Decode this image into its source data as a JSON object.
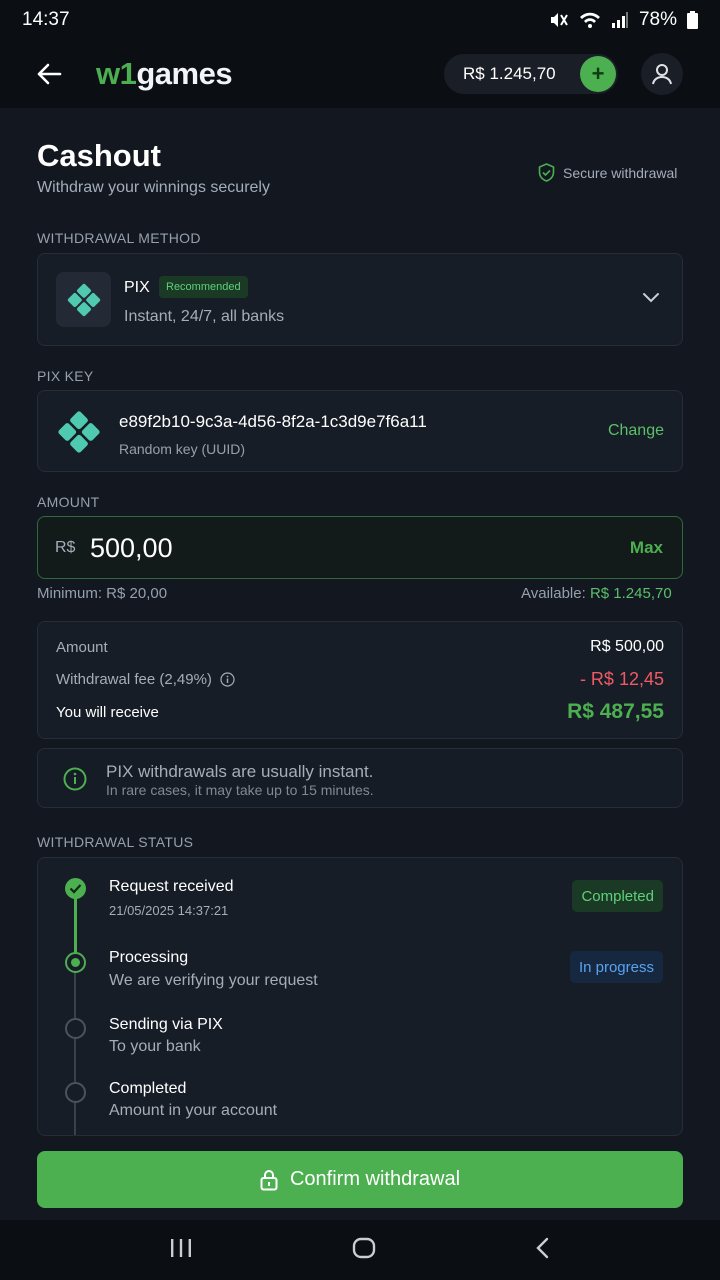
{
  "status_bar": {
    "time": "14:37",
    "battery": "78%"
  },
  "header": {
    "logo_prefix": "w1",
    "logo_suffix": "games",
    "balance": "R$ 1.245,70"
  },
  "page": {
    "title": "Cashout",
    "subtitle": "Withdraw your winnings securely",
    "secure_label": "Secure withdrawal"
  },
  "method": {
    "section_label": "WITHDRAWAL METHOD",
    "name": "PIX",
    "badge": "Recommended",
    "description": "Instant, 24/7, all banks"
  },
  "pix_key": {
    "section_label": "PIX KEY",
    "value": "e89f2b10-9c3a-4d56-8f2a-1c3d9e7f6a11",
    "type": "Random key (UUID)",
    "change_label": "Change"
  },
  "amount": {
    "section_label": "AMOUNT",
    "currency": "R$",
    "value": "500,00",
    "max_label": "Max",
    "minimum": "Minimum: R$ 20,00",
    "available_label": "Available:",
    "available_value": "R$ 1.245,70"
  },
  "summary": {
    "amount_label": "Amount",
    "amount_value": "R$ 500,00",
    "fee_label": "Withdrawal fee (2,49%)",
    "fee_value": "- R$ 12,45",
    "receive_label": "You will receive",
    "receive_value": "R$ 487,55"
  },
  "info": {
    "main": "PIX withdrawals are usually instant.",
    "sub": "In rare cases, it may take up to 15 minutes."
  },
  "status": {
    "section_label": "WITHDRAWAL STATUS",
    "steps": [
      {
        "title": "Request received",
        "sub": "21/05/2025 14:37:21",
        "badge": "Completed"
      },
      {
        "title": "Processing",
        "sub": "We are verifying your request",
        "badge": "In progress"
      },
      {
        "title": "Sending via PIX",
        "sub": "To your bank"
      },
      {
        "title": "Completed",
        "sub": "Amount in your account"
      }
    ]
  },
  "confirm_label": "Confirm withdrawal",
  "colors": {
    "accent_green": "#4caf50",
    "fee_red": "#ef5a65",
    "progress_blue": "#5aa2f0",
    "background": "#0b0e13"
  }
}
